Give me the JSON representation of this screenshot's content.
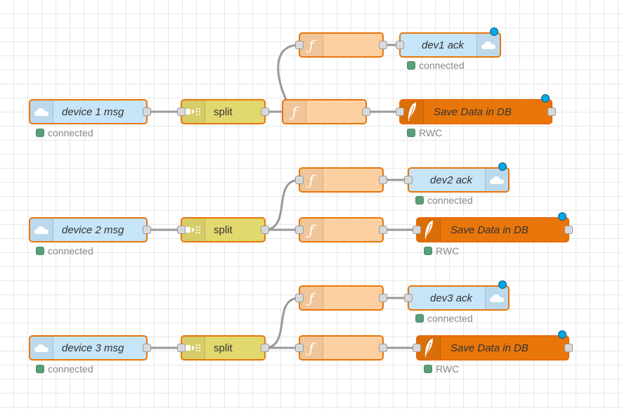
{
  "flow": {
    "groups": [
      {
        "input": {
          "label": "device 1 msg",
          "status": "connected"
        },
        "split": {
          "label": "split"
        },
        "ack": {
          "label": "dev1 ack",
          "status": "connected"
        },
        "db": {
          "label": "Save Data in DB",
          "status": "RWC"
        }
      },
      {
        "input": {
          "label": "device 2 msg",
          "status": "connected"
        },
        "split": {
          "label": "split"
        },
        "ack": {
          "label": "dev2 ack",
          "status": "connected"
        },
        "db": {
          "label": "Save Data in DB",
          "status": "RWC"
        }
      },
      {
        "input": {
          "label": "device 3 msg",
          "status": "connected"
        },
        "split": {
          "label": "split"
        },
        "ack": {
          "label": "dev3 ack",
          "status": "connected"
        },
        "db": {
          "label": "Save Data in DB",
          "status": "RWC"
        }
      }
    ]
  },
  "colors": {
    "mqtt_node": "#c6e5f8",
    "split_node": "#e2d96e",
    "function_node": "#fdd0a2",
    "db_node": "#e8760a",
    "node_border": "#e8760a",
    "changed_indicator": "#00a8e8",
    "status_connected": "#5a9e7a",
    "wire": "#999999"
  },
  "icons": {
    "mqtt": "cloud-icon",
    "split": "split-icon",
    "function": "function-icon",
    "db": "feather-icon"
  }
}
